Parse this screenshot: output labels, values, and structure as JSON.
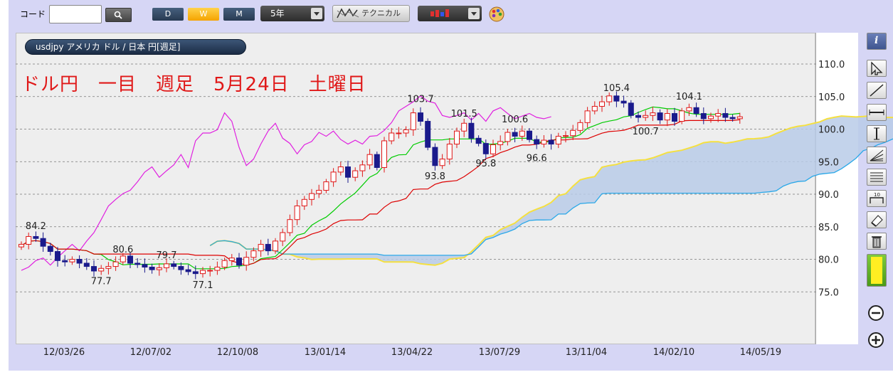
{
  "toolbar": {
    "code_label": "コード",
    "code_value": "",
    "period_buttons": [
      "D",
      "W",
      "M"
    ],
    "active_period": "W",
    "range_select": "5年",
    "technical_label": "テクニカル"
  },
  "header": {
    "ticker": "usdjpy アメリカ ドル / 日本 円[週足]",
    "title": "ドル円　一目　週足　5月24日　土曜日"
  },
  "colors": {
    "bull": "#e01818",
    "bear": "#1a1a8c",
    "tenkan": "#00cc00",
    "kijun": "#dd0000",
    "chikou": "#e020e0",
    "kumo_bull": "#b8cbe8",
    "kumo_bear": "#f2b8c8",
    "span_a": "#f5e040",
    "span_b": "#2aa8e8"
  },
  "chart_data": {
    "type": "candlestick-ichimoku",
    "interval": "weekly",
    "ylim": [
      70,
      115
    ],
    "yticks": [
      75.0,
      80.0,
      85.0,
      90.0,
      95.0,
      100.0,
      105.0,
      110.0
    ],
    "ytick_labels": [
      "75.0",
      "80.0",
      "85.0",
      "90.0",
      "95.0",
      "100.0",
      "105.0",
      "110.0"
    ],
    "xticks": [
      "12/03/26",
      "12/07/02",
      "12/10/08",
      "13/01/14",
      "13/04/22",
      "13/07/29",
      "13/11/04",
      "14/02/10",
      "14/05/19"
    ],
    "annotations": [
      {
        "text": "84.2",
        "week": 2,
        "value": 84.2
      },
      {
        "text": "77.7",
        "week": 11,
        "value": 77.7
      },
      {
        "text": "80.6",
        "week": 14,
        "value": 80.6
      },
      {
        "text": "79.7",
        "week": 20,
        "value": 79.7
      },
      {
        "text": "77.1",
        "week": 25,
        "value": 77.1
      },
      {
        "text": "103.7",
        "week": 55,
        "value": 103.7
      },
      {
        "text": "93.8",
        "week": 57,
        "value": 93.8
      },
      {
        "text": "101.5",
        "week": 61,
        "value": 101.5
      },
      {
        "text": "95.8",
        "week": 64,
        "value": 95.8
      },
      {
        "text": "100.6",
        "week": 68,
        "value": 100.6
      },
      {
        "text": "96.6",
        "week": 71,
        "value": 96.6
      },
      {
        "text": "105.4",
        "week": 82,
        "value": 105.4
      },
      {
        "text": "100.7",
        "week": 86,
        "value": 100.7
      },
      {
        "text": "104.1",
        "week": 92,
        "value": 104.1
      }
    ],
    "closes": [
      82.3,
      83.5,
      83.2,
      82.0,
      81.2,
      79.8,
      79.6,
      80.0,
      79.4,
      78.9,
      78.2,
      78.6,
      78.9,
      79.6,
      80.5,
      79.4,
      79.2,
      78.8,
      78.4,
      78.7,
      79.3,
      78.9,
      78.4,
      78.1,
      77.8,
      78.3,
      78.3,
      78.8,
      79.8,
      80.2,
      79.1,
      80.3,
      81.3,
      82.3,
      81.3,
      82.8,
      84.1,
      86.1,
      88.2,
      89.2,
      90.1,
      90.6,
      91.9,
      93.4,
      94.2,
      92.6,
      93.6,
      94.5,
      96.1,
      94.1,
      98.2,
      99.4,
      99.4,
      99.9,
      102.5,
      101.2,
      97.2,
      94.4,
      95.4,
      97.7,
      99.7,
      100.9,
      98.6,
      97.8,
      96.2,
      97.6,
      98.1,
      99.5,
      98.9,
      99.7,
      98.4,
      97.7,
      98.3,
      97.7,
      98.9,
      99.0,
      99.8,
      101.0,
      102.8,
      103.5,
      104.2,
      105.1,
      104.3,
      104.0,
      102.1,
      101.8,
      102.1,
      102.5,
      101.4,
      102.4,
      101.2,
      102.8,
      103.3,
      102.4,
      101.6,
      102.0,
      102.4,
      101.8,
      101.6,
      101.9
    ]
  }
}
